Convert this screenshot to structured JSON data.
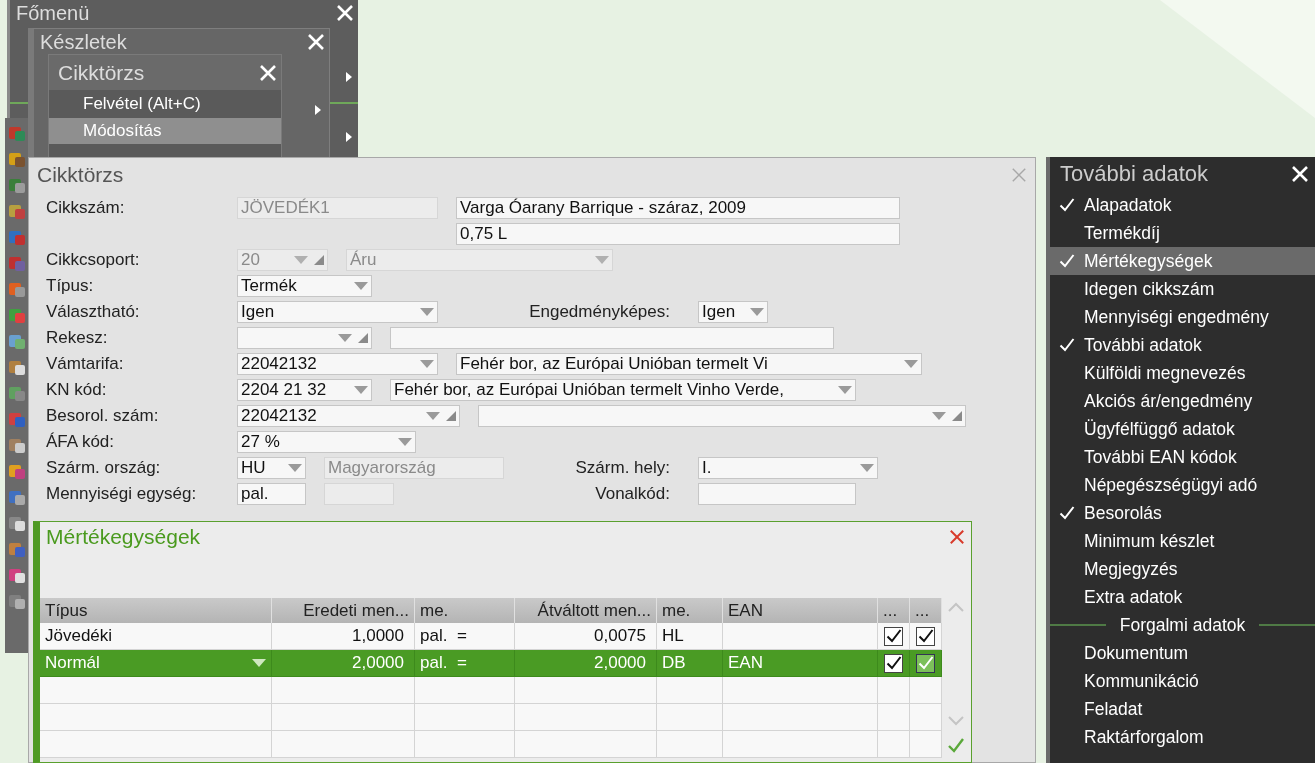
{
  "main_menu": {
    "title": "Főmenü"
  },
  "stock_menu": {
    "title": "Készletek"
  },
  "item_menu": {
    "title": "Cikktörzs",
    "items": [
      {
        "label": "Felvétel (Alt+C)",
        "selected": false
      },
      {
        "label": "Módosítás",
        "selected": true
      }
    ]
  },
  "dialog": {
    "title": "Cikktörzs",
    "rows": [
      {
        "label": "Cikkszám:",
        "fields": [
          {
            "kind": "text",
            "value": "JÖVEDÉK1",
            "disabled": true
          },
          {
            "kind": "text",
            "value": "Varga Óarany Barrique - száraz, 2009",
            "disabled": false
          }
        ]
      },
      {
        "fields": [
          {
            "kind": "text",
            "value": "0,75 L",
            "disabled": false
          }
        ]
      },
      {
        "label": "Cikkcsoport:",
        "fields": [
          {
            "kind": "lookup",
            "value": "20",
            "disabled": true
          },
          {
            "kind": "select",
            "value": "Áru",
            "disabled": true
          }
        ]
      },
      {
        "label": "Típus:",
        "fields": [
          {
            "kind": "select",
            "value": "Termék",
            "disabled": false
          }
        ]
      },
      {
        "label": "Választható:",
        "fields": [
          {
            "kind": "select",
            "value": "Igen",
            "disabled": false
          },
          {
            "kind": "label",
            "value": "Engedményképes:"
          },
          {
            "kind": "select",
            "value": "Igen",
            "disabled": false
          }
        ]
      },
      {
        "label": "Rekesz:",
        "fields": [
          {
            "kind": "lookup",
            "disabled": false
          },
          {
            "kind": "text",
            "disabled": false
          }
        ]
      },
      {
        "label": "Vámtarifa:",
        "fields": [
          {
            "kind": "select",
            "value": "22042132",
            "disabled": false
          },
          {
            "kind": "select",
            "value": "Fehér bor, az Európai Unióban termelt Vi",
            "disabled": false
          }
        ]
      },
      {
        "label": "KN kód:",
        "fields": [
          {
            "kind": "select",
            "value": "2204 21 32",
            "disabled": false
          },
          {
            "kind": "select",
            "value": "Fehér bor, az Európai Unióban termelt Vinho Verde,",
            "disabled": false
          }
        ]
      },
      {
        "label": "Besorol. szám:",
        "fields": [
          {
            "kind": "lookup",
            "value": "22042132",
            "disabled": false
          },
          {
            "kind": "lookup",
            "disabled": false
          }
        ]
      },
      {
        "label": "ÁFA kód:",
        "fields": [
          {
            "kind": "select",
            "value": "27 %",
            "disabled": false
          }
        ]
      },
      {
        "label": "Szárm. ország:",
        "fields": [
          {
            "kind": "select",
            "value": "HU",
            "disabled": false
          },
          {
            "kind": "text",
            "value": "Magyarország",
            "disabled": true
          },
          {
            "kind": "label",
            "value": "Szárm. hely:"
          },
          {
            "kind": "select",
            "value": "I.",
            "disabled": false
          }
        ]
      },
      {
        "label": "Mennyiségi egység:",
        "fields": [
          {
            "kind": "text",
            "value": "pal.",
            "disabled": false
          },
          {
            "kind": "text",
            "disabled": true
          },
          {
            "kind": "label",
            "value": "Vonalkód:"
          },
          {
            "kind": "text",
            "disabled": false
          }
        ]
      }
    ]
  },
  "units_window": {
    "title": "Mértékegységek",
    "columns": [
      "Típus",
      "Eredeti men...",
      "me.",
      "Átváltott men...",
      "me.",
      "EAN",
      "...",
      "..."
    ],
    "rows": [
      {
        "selected": false,
        "type": "Jövedéki",
        "original": "1,0000",
        "unit_from": "pal.",
        "sign": "=",
        "converted": "0,0075",
        "unit_to": "HL",
        "check_1": true,
        "check_2": true
      },
      {
        "selected": true,
        "type": "Normál",
        "original": "2,0000",
        "unit_from": "pal.",
        "sign": "=",
        "converted": "2,0000",
        "unit_to": "DB",
        "ean_placeholder": "EAN",
        "check_1": true,
        "check_2": true
      }
    ]
  },
  "extra_panel": {
    "title": "További adatok",
    "items": [
      {
        "label": "Alapadatok",
        "checked": true,
        "selected": false
      },
      {
        "label": "Termékdíj",
        "checked": false,
        "selected": false
      },
      {
        "label": "Mértékegységek",
        "checked": true,
        "selected": true
      },
      {
        "label": "Idegen cikkszám",
        "checked": false,
        "selected": false
      },
      {
        "label": "Mennyiségi engedmény",
        "checked": false,
        "selected": false
      },
      {
        "label": "További adatok",
        "checked": true,
        "selected": false
      },
      {
        "label": "Külföldi megnevezés",
        "checked": false,
        "selected": false
      },
      {
        "label": "Akciós ár/engedmény",
        "checked": false,
        "selected": false
      },
      {
        "label": "Ügyfélfüggő adatok",
        "checked": false,
        "selected": false
      },
      {
        "label": "További EAN kódok",
        "checked": false,
        "selected": false
      },
      {
        "label": "Népegészségügyi adó",
        "checked": false,
        "selected": false
      },
      {
        "label": "Besorolás",
        "checked": true,
        "selected": false
      },
      {
        "label": "Minimum készlet",
        "checked": false,
        "selected": false
      },
      {
        "label": "Megjegyzés",
        "checked": false,
        "selected": false
      },
      {
        "label": "Extra adatok",
        "checked": false,
        "selected": false
      }
    ],
    "section": "Forgalmi adatok",
    "section_items": [
      {
        "label": "Dokumentum",
        "checked": false,
        "selected": false
      },
      {
        "label": "Kommunikáció",
        "checked": false,
        "selected": false
      },
      {
        "label": "Feladat",
        "checked": false,
        "selected": false
      },
      {
        "label": "Raktárforgalom",
        "checked": false,
        "selected": false
      }
    ]
  }
}
